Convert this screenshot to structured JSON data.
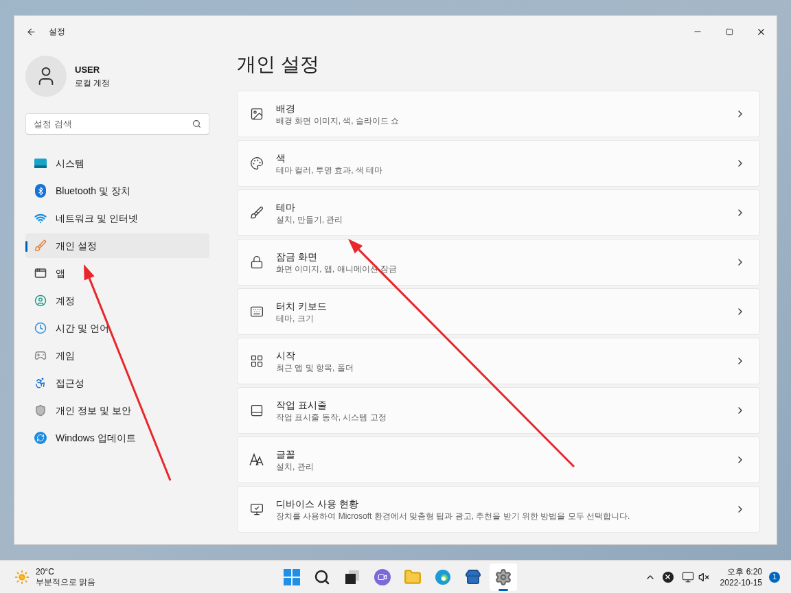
{
  "window": {
    "title": "설정"
  },
  "user": {
    "name": "USER",
    "account": "로컬 계정"
  },
  "search": {
    "placeholder": "설정 검색"
  },
  "nav": [
    {
      "label": "시스템",
      "selected": false
    },
    {
      "label": "Bluetooth 및 장치",
      "selected": false
    },
    {
      "label": "네트워크 및 인터넷",
      "selected": false
    },
    {
      "label": "개인 설정",
      "selected": true
    },
    {
      "label": "앱",
      "selected": false
    },
    {
      "label": "계정",
      "selected": false
    },
    {
      "label": "시간 및 언어",
      "selected": false
    },
    {
      "label": "게임",
      "selected": false
    },
    {
      "label": "접근성",
      "selected": false
    },
    {
      "label": "개인 정보 및 보안",
      "selected": false
    },
    {
      "label": "Windows 업데이트",
      "selected": false
    }
  ],
  "page_title": "개인 설정",
  "cards": [
    {
      "title": "배경",
      "subtitle": "배경 화면 이미지, 색, 슬라이드 쇼"
    },
    {
      "title": "색",
      "subtitle": "테마 컬러, 투명 효과, 색 테마"
    },
    {
      "title": "테마",
      "subtitle": "설치, 만들기, 관리"
    },
    {
      "title": "잠금 화면",
      "subtitle": "화면 이미지, 앱, 애니메이션 잠금"
    },
    {
      "title": "터치 키보드",
      "subtitle": "테마, 크기"
    },
    {
      "title": "시작",
      "subtitle": "최근 앱 및 항목, 폴더"
    },
    {
      "title": "작업 표시줄",
      "subtitle": "작업 표시줄 동작, 시스템 고정"
    },
    {
      "title": "글꼴",
      "subtitle": "설치, 관리"
    },
    {
      "title": "디바이스 사용 현황",
      "subtitle": "장치를 사용하여 Microsoft 환경에서 맞춤형 팁과 광고, 추천을 받기 위한 방법을 모두 선택합니다."
    }
  ],
  "taskbar": {
    "weather": {
      "temperature": "20°C",
      "condition": "부분적으로 맑음"
    },
    "apps": [
      {
        "selected": false
      },
      {
        "selected": false
      },
      {
        "selected": false
      },
      {
        "selected": false
      },
      {
        "selected": false
      },
      {
        "selected": false
      },
      {
        "selected": false
      },
      {
        "selected": true
      }
    ],
    "clock": {
      "time": "오후 6:20",
      "date": "2022-10-15"
    },
    "notification_count": "1"
  }
}
